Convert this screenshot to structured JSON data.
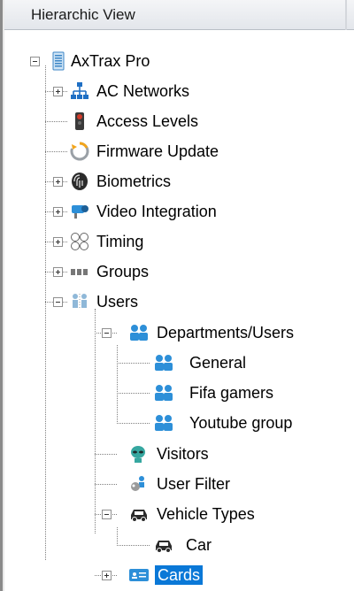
{
  "panel": {
    "title": "Hierarchic View"
  },
  "tree": {
    "root": {
      "label": "AxTrax Pro",
      "icon": "server-icon"
    },
    "items": [
      {
        "label": "AC Networks",
        "icon": "network-icon",
        "expandable": true,
        "expanded": false
      },
      {
        "label": "Access Levels",
        "icon": "traffic-light-icon",
        "expandable": false
      },
      {
        "label": "Firmware Update",
        "icon": "update-icon",
        "expandable": false
      },
      {
        "label": "Biometrics",
        "icon": "fingerprint-icon",
        "expandable": true,
        "expanded": false
      },
      {
        "label": "Video Integration",
        "icon": "camera-icon",
        "expandable": true,
        "expanded": false
      },
      {
        "label": "Timing",
        "icon": "clock-icon",
        "expandable": true,
        "expanded": false
      },
      {
        "label": "Groups",
        "icon": "groups-icon",
        "expandable": true,
        "expanded": false
      },
      {
        "label": "Users",
        "icon": "users-icon",
        "expandable": true,
        "expanded": true
      },
      {
        "label": "Departments/Users",
        "icon": "department-icon",
        "expandable": true,
        "expanded": true
      },
      {
        "label": "General",
        "icon": "user-group-icon"
      },
      {
        "label": "Fifa gamers",
        "icon": "user-group-icon"
      },
      {
        "label": "Youtube group",
        "icon": "user-group-icon"
      },
      {
        "label": "Visitors",
        "icon": "alien-icon"
      },
      {
        "label": "User Filter",
        "icon": "filter-users-icon"
      },
      {
        "label": "Vehicle Types",
        "icon": "car-icon",
        "expandable": true,
        "expanded": true
      },
      {
        "label": "Car",
        "icon": "car-icon"
      },
      {
        "label": "Cards",
        "icon": "card-icon",
        "expandable": true,
        "expanded": false,
        "selected": true
      }
    ]
  },
  "colors": {
    "selection": "#0a78d7",
    "user_blue": "#2d8fd8",
    "network_blue": "#1f6fc4",
    "access_red": "#d23b2a"
  }
}
